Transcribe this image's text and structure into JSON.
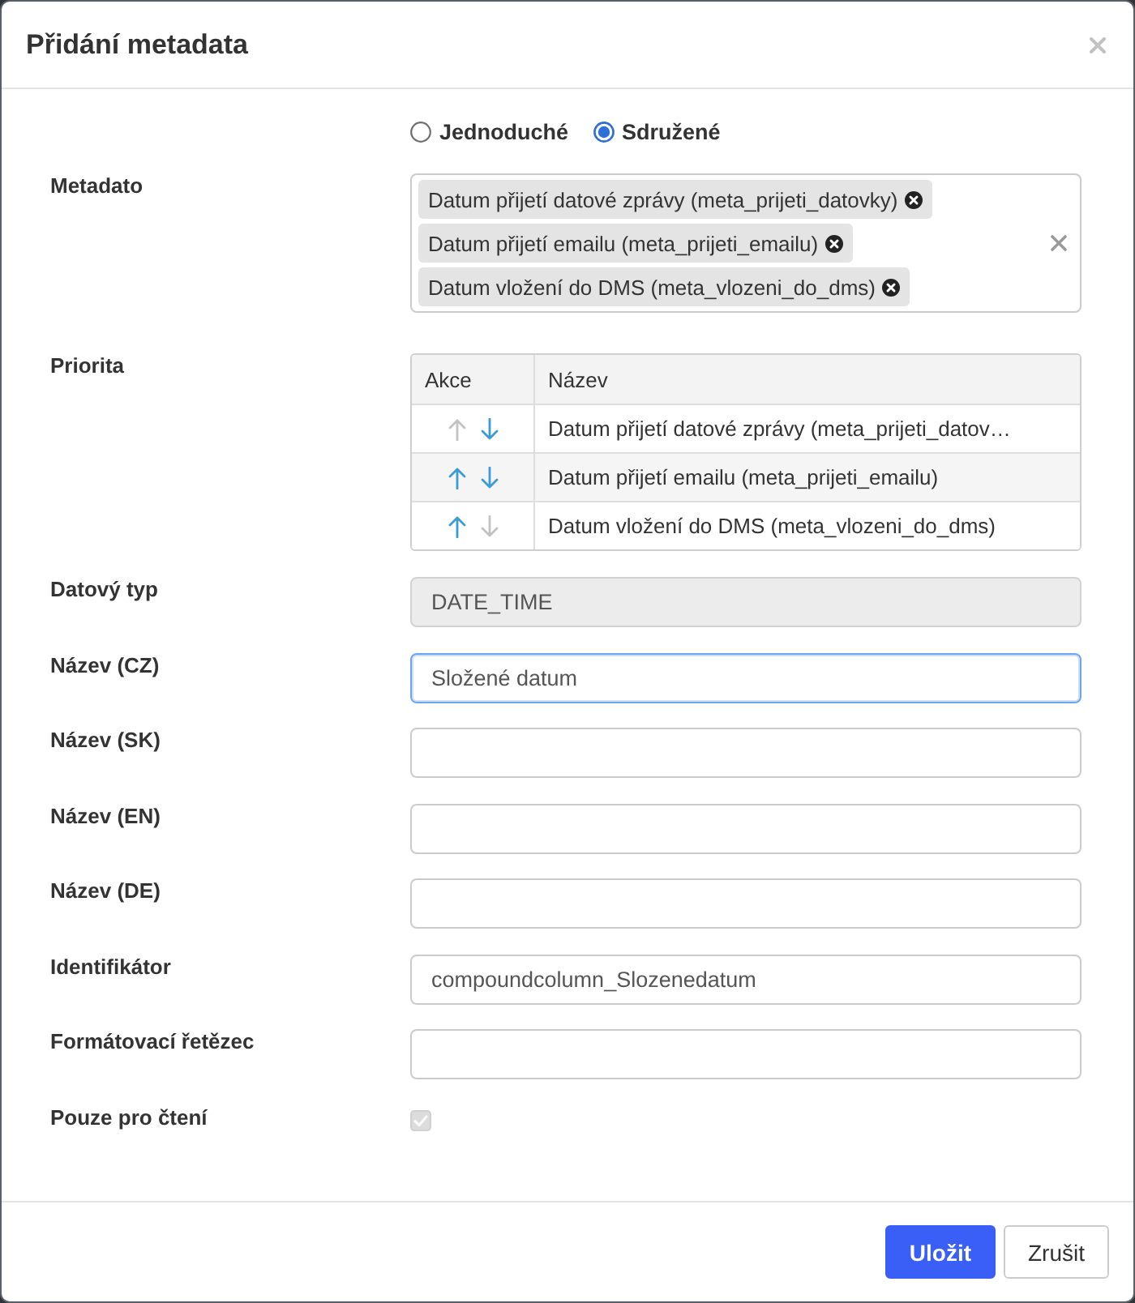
{
  "dialog": {
    "title": "Přidání metadata"
  },
  "type_options": [
    {
      "label": "Jednoduché",
      "selected": false
    },
    {
      "label": "Sdružené",
      "selected": true
    }
  ],
  "metadata": {
    "label": "Metadato",
    "tags": [
      "Datum přijetí datové zprávy (meta_prijeti_datovky)",
      "Datum přijetí emailu (meta_prijeti_emailu)",
      "Datum vložení do DMS (meta_vlozeni_do_dms)"
    ]
  },
  "priority": {
    "label": "Priorita",
    "columns": [
      "Akce",
      "Název"
    ],
    "rows": [
      {
        "name": "Datum přijetí datové zprávy (meta_prijeti_datov…",
        "up_enabled": false,
        "down_enabled": true
      },
      {
        "name": "Datum přijetí emailu (meta_prijeti_emailu)",
        "up_enabled": true,
        "down_enabled": true
      },
      {
        "name": "Datum vložení do DMS (meta_vlozeni_do_dms)",
        "up_enabled": true,
        "down_enabled": false
      }
    ]
  },
  "fields": [
    {
      "label": "Datový typ",
      "kind": "text",
      "value": "DATE_TIME",
      "disabled": true,
      "focused": false
    },
    {
      "label": "Název (CZ)",
      "kind": "text",
      "value": "Složené datum",
      "disabled": false,
      "focused": true
    },
    {
      "label": "Název (SK)",
      "kind": "text",
      "disabled": false,
      "focused": false
    },
    {
      "label": "Název (EN)",
      "kind": "text",
      "disabled": false,
      "focused": false
    },
    {
      "label": "Název (DE)",
      "kind": "text",
      "disabled": false,
      "focused": false
    },
    {
      "label": "Identifikátor",
      "kind": "text",
      "value": "compoundcolumn_Slozenedatum",
      "disabled": false,
      "focused": false
    },
    {
      "label": "Formátovací řetězec",
      "kind": "text",
      "disabled": false,
      "focused": false
    },
    {
      "label": "Pouze pro čtení",
      "kind": "checkbox",
      "checked": true,
      "disabled": true,
      "focused": false
    }
  ],
  "buttons": [
    {
      "label": "Uložit",
      "kind": "primary"
    },
    {
      "label": "Zrušit",
      "kind": "secondary"
    }
  ]
}
